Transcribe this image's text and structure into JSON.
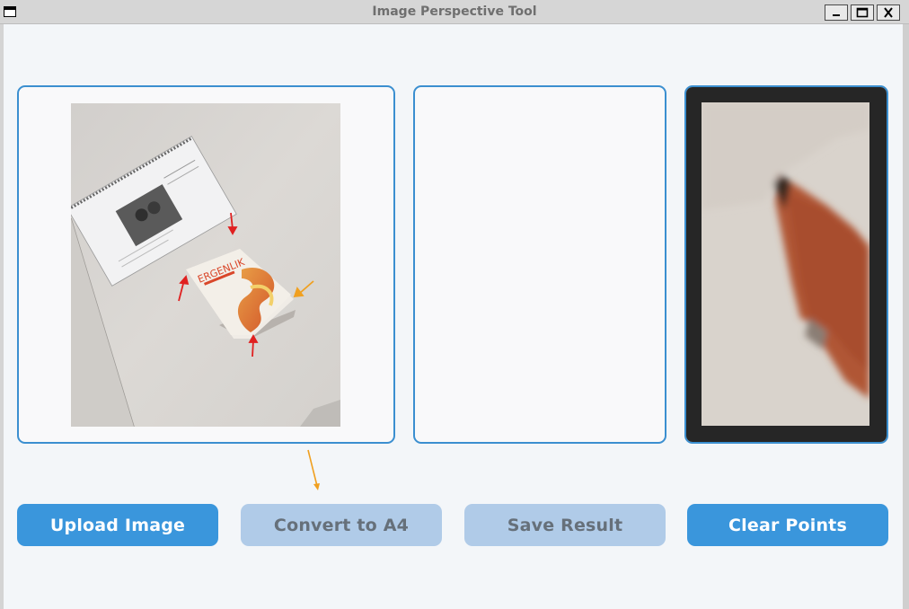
{
  "window": {
    "title": "Image Perspective Tool",
    "app_icon": "window-icon",
    "controls": [
      "minimize-icon",
      "maximize-icon",
      "close-icon"
    ]
  },
  "panels": {
    "source": {
      "content": "uploaded photo of two books on a white table with red and orange arrow markers",
      "book_title": "ERGENLIK"
    },
    "result": {
      "content": "empty"
    },
    "preview": {
      "content": "zoomed crop of book corner"
    }
  },
  "buttons": {
    "upload": "Upload Image",
    "convert": "Convert to A4",
    "save": "Save Result",
    "clear": "Clear Points"
  },
  "colors": {
    "accent": "#3a96dc",
    "disabled": "#b0cbe8",
    "panel_border": "#3b8fd0",
    "marker_red": "#e02020",
    "marker_orange": "#f0a020"
  }
}
